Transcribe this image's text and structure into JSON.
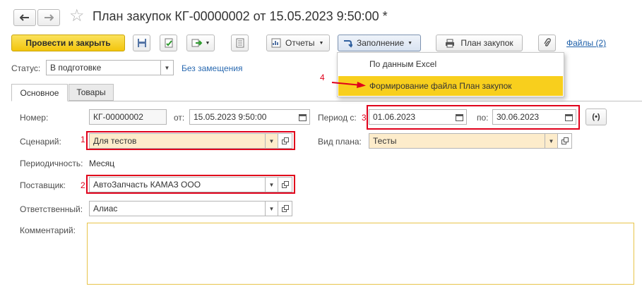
{
  "window": {
    "title": "План закупок КГ-00000002 от 15.05.2023 9:50:00 *",
    "star": "☆"
  },
  "toolbar": {
    "post_close_label": "Провести и закрыть",
    "reports_label": "Отчеты",
    "fill_label": "Заполнение",
    "plan_label": "План закупок",
    "files_label": "Файлы (2)"
  },
  "fill_menu": {
    "items": [
      "По данным Excel",
      "Формирование файла План закупок"
    ]
  },
  "status": {
    "label": "Статус:",
    "value": "В подготовке",
    "link": "Без замещения"
  },
  "tabs": [
    "Основное",
    "Товары"
  ],
  "form": {
    "number_label": "Номер:",
    "number_value": "КГ-00000002",
    "from_label": "от:",
    "from_value": "15.05.2023  9:50:00",
    "period_label": "Период с:",
    "period_from": "01.06.2023",
    "period_to_label": "по:",
    "period_to": "30.06.2023",
    "scenario_label": "Сценарий:",
    "scenario_value": "Для тестов",
    "plan_type_label": "Вид плана:",
    "plan_type_value": "Тесты",
    "periodicity_label": "Периодичность:",
    "periodicity_value": "Месяц",
    "supplier_label": "Поставщик:",
    "supplier_value": "АвтоЗапчасть КАМАЗ ООО",
    "responsible_label": "Ответственный:",
    "responsible_value": "Алиас",
    "comment_label": "Комментарий:",
    "comment_value": ""
  },
  "annotations": {
    "n1": "1",
    "n2": "2",
    "n3": "3",
    "n4": "4"
  },
  "colors": {
    "annotation_red": "#e0001b",
    "primary_yellow": "#f3c50c",
    "highlight_yellow": "#f8cf1d",
    "link_blue": "#1c5ea8"
  }
}
